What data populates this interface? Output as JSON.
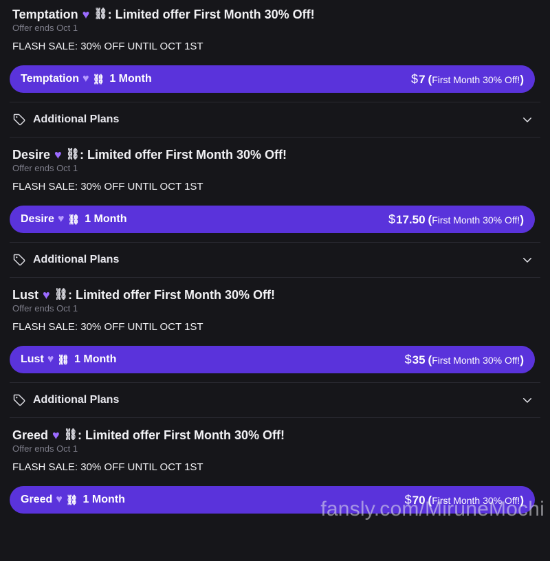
{
  "tiers": [
    {
      "name": "Temptation",
      "title_suffix": ": Limited offer First Month 30% Off!",
      "offer_ends": "Offer ends Oct 1",
      "description": "FLASH SALE: 30% OFF UNTIL OCT 1ST",
      "button_name": "Temptation",
      "duration": "1 Month",
      "currency": "$",
      "price": "7",
      "price_note": "First Month 30% Off!",
      "additional_plans_label": "Additional Plans"
    },
    {
      "name": "Desire",
      "title_suffix": ": Limited offer First Month 30% Off!",
      "offer_ends": "Offer ends Oct 1",
      "description": "FLASH SALE: 30% OFF UNTIL OCT 1ST",
      "button_name": "Desire",
      "duration": "1 Month",
      "currency": "$",
      "price": "17.50",
      "price_note": "First Month 30% Off!",
      "additional_plans_label": "Additional Plans"
    },
    {
      "name": "Lust",
      "title_suffix": ": Limited offer First Month 30% Off!",
      "offer_ends": "Offer ends Oct 1",
      "description": "FLASH SALE: 30% OFF UNTIL OCT 1ST",
      "button_name": "Lust",
      "duration": "1 Month",
      "currency": "$",
      "price": "35",
      "price_note": "First Month 30% Off!",
      "additional_plans_label": "Additional Plans"
    },
    {
      "name": "Greed",
      "title_suffix": ": Limited offer First Month 30% Off!",
      "offer_ends": "Offer ends Oct 1",
      "description": "FLASH SALE: 30% OFF UNTIL OCT 1ST",
      "button_name": "Greed",
      "duration": "1 Month",
      "currency": "$",
      "price": "70",
      "price_note": "First Month 30% Off!"
    }
  ],
  "icons": {
    "heart": "purple-heart-icon",
    "chain": "chain-link-icon",
    "tag": "tag-icon",
    "chevron": "chevron-down-icon"
  },
  "colors": {
    "background": "#16161a",
    "accent_button": "#5a33db",
    "heart": "#9b6bff",
    "muted_text": "#7d7d89"
  },
  "watermark": "fansly.com/MiruneMochi"
}
